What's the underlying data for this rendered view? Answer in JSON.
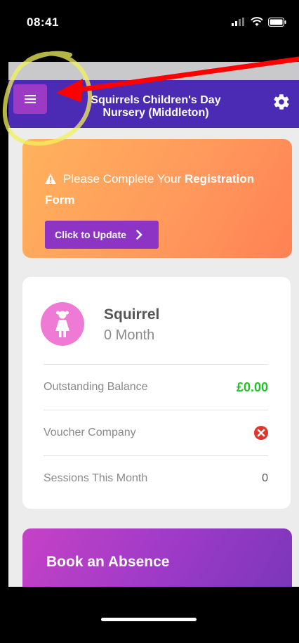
{
  "status_bar": {
    "time": "08:41"
  },
  "header": {
    "title_line1": "Squirrels Children's Day",
    "title_line2": "Nursery (Middleton)"
  },
  "registration_notice": {
    "text_prefix": "Please Complete Your ",
    "text_bold": "Registration",
    "text_suffix": "Form",
    "button_label": "Click to Update"
  },
  "child": {
    "name": "Squirrel",
    "age": "0 Month",
    "rows": [
      {
        "label": "Outstanding Balance",
        "value": "£0.00"
      },
      {
        "label": "Voucher Company",
        "value": ""
      },
      {
        "label": "Sessions This Month",
        "value": "0"
      }
    ]
  },
  "absence": {
    "title": "Book an Absence"
  },
  "colors": {
    "header_bg": "#4c2bb4",
    "menu_button": "#9b3ac4",
    "balance_green": "#22c12b",
    "error_red": "#e0342f"
  }
}
